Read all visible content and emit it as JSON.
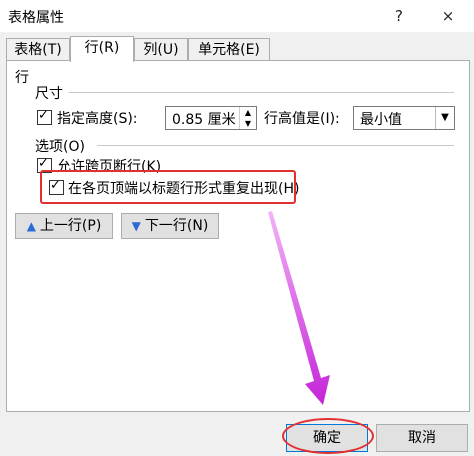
{
  "window": {
    "title": "表格属性",
    "help": "?",
    "close": "×"
  },
  "tabs": [
    {
      "label": "表格(T)"
    },
    {
      "label": "行(R)"
    },
    {
      "label": "列(U)"
    },
    {
      "label": "单元格(E)"
    }
  ],
  "row": {
    "section_title": "行",
    "size_title": "尺寸",
    "specify_height_label": "指定高度(S):",
    "specify_height_checked": true,
    "height_value": "0.85 厘米",
    "height_rule_label": "行高值是(I):",
    "height_rule_value": "最小值",
    "options_title": "选项(O)",
    "allow_break_label": "允许跨页断行(K)",
    "allow_break_checked": true,
    "repeat_header_label": "在各页顶端以标题行形式重复出现(H)",
    "repeat_header_checked": true,
    "prev_row_label": "上一行(P)",
    "next_row_label": "下一行(N)"
  },
  "footer": {
    "ok_label": "确定",
    "cancel_label": "取消"
  },
  "annotation_colors": {
    "highlight": "#e0302f",
    "arrow": "#d23be0"
  }
}
